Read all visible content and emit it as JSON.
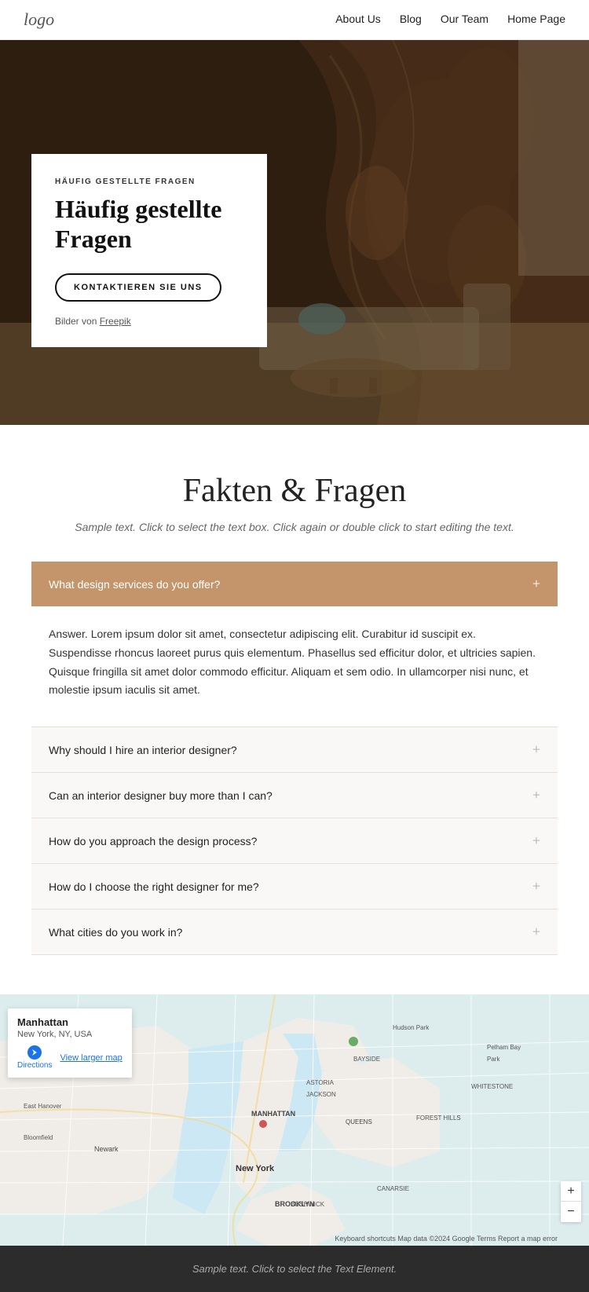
{
  "nav": {
    "logo": "logo",
    "links": [
      {
        "label": "About Us",
        "href": "#"
      },
      {
        "label": "Blog",
        "href": "#"
      },
      {
        "label": "Our Team",
        "href": "#"
      },
      {
        "label": "Home Page",
        "href": "#"
      }
    ]
  },
  "hero": {
    "subtitle": "Häufig gestellte Fragen",
    "title": "Häufig gestellte Fragen",
    "button_label": "Kontaktieren Sie uns",
    "credit_prefix": "Bilder von ",
    "credit_link": "Freepik"
  },
  "faq_section": {
    "main_title": "Fakten & Fragen",
    "main_subtitle": "Sample text. Click to select the text box. Click again or double click to start editing the text.",
    "active_item": {
      "question": "What design services do you offer?",
      "answer": "Answer. Lorem ipsum dolor sit amet, consectetur adipiscing elit. Curabitur id suscipit ex. Suspendisse rhoncus laoreet purus quis elementum. Phasellus sed efficitur dolor, et ultricies sapien. Quisque fringilla sit amet dolor commodo efficitur. Aliquam et sem odio. In ullamcorper nisi nunc, et molestie ipsum iaculis sit amet."
    },
    "items": [
      {
        "question": "Why should I hire an interior designer?"
      },
      {
        "question": "Can an interior designer buy more than I can?"
      },
      {
        "question": "How do you approach the design process?"
      },
      {
        "question": "How do I choose the right designer for me?"
      },
      {
        "question": "What cities do you work in?"
      }
    ]
  },
  "map": {
    "popup_title": "Manhattan",
    "popup_address": "New York, NY, USA",
    "directions_label": "Directions",
    "larger_map_label": "View larger map",
    "attribution": "Keyboard shortcuts  Map data ©2024 Google  Terms  Report a map error",
    "zoom_in": "+",
    "zoom_out": "−"
  },
  "footer": {
    "text": "Sample text. Click to select the Text Element."
  }
}
